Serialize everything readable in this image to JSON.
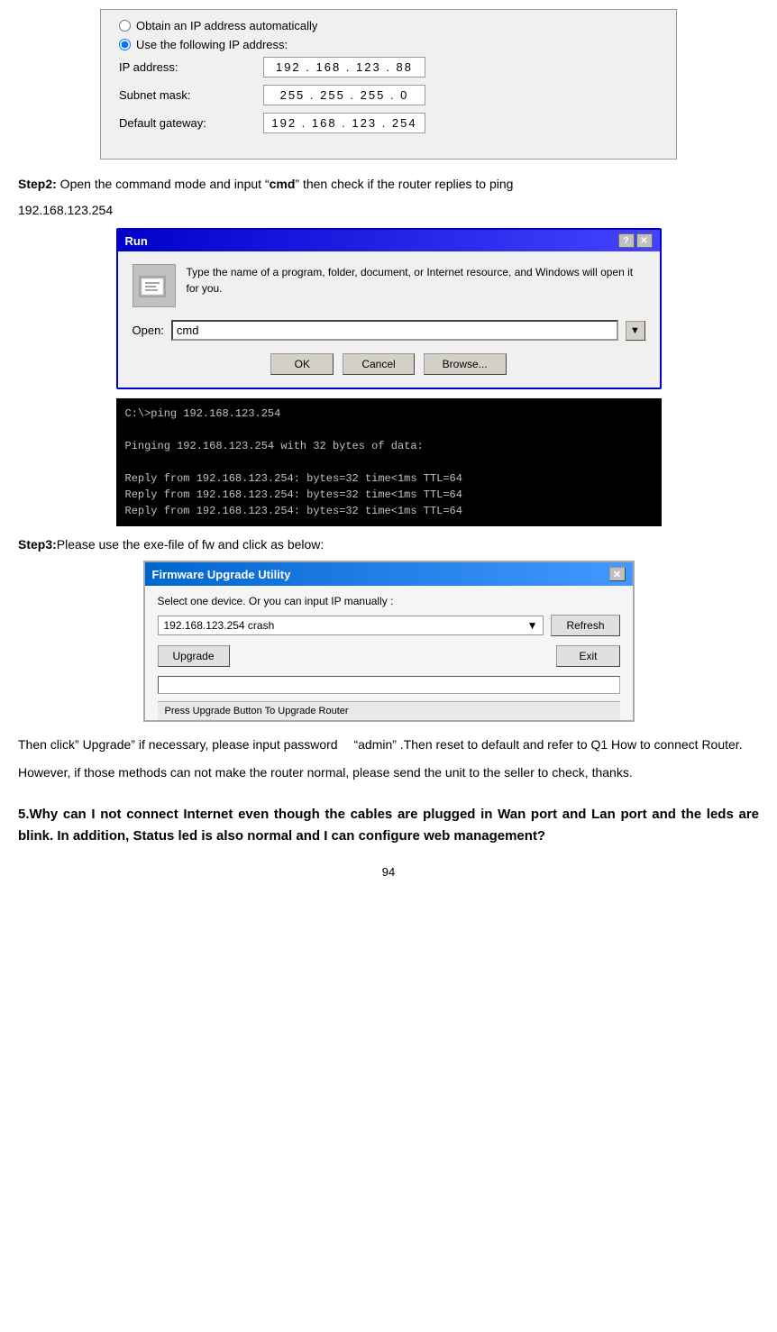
{
  "network_screenshot": {
    "obtain_auto_label": "Obtain an IP address automatically",
    "use_following_label": "Use the following IP address:",
    "ip_address_label": "IP address:",
    "ip_address_value": "192 . 168 . 123 . 88",
    "subnet_mask_label": "Subnet mask:",
    "subnet_mask_value": "255 . 255 . 255 . 0",
    "default_gateway_label": "Default gateway:",
    "default_gateway_value": "192 . 168 . 123 . 254"
  },
  "step2": {
    "label": "Step2:",
    "text": " Open the command mode and input “",
    "cmd": "cmd",
    "text2": "” then check if the router replies to ping"
  },
  "step2_ip": "192.168.123.254",
  "run_dialog": {
    "title": "Run",
    "description": "Type the name of a program, folder, document, or Internet resource, and Windows will open it for you.",
    "open_label": "Open:",
    "open_value": "cmd",
    "ok_label": "OK",
    "cancel_label": "Cancel",
    "browse_label": "Browse..."
  },
  "cmd_lines": [
    "C:\\>ping 192.168.123.254",
    "",
    "Pinging 192.168.123.254 with 32 bytes of data:",
    "",
    "Reply from 192.168.123.254: bytes=32 time<1ms TTL=64",
    "Reply from 192.168.123.254: bytes=32 time<1ms TTL=64",
    "Reply from 192.168.123.254: bytes=32 time<1ms TTL=64"
  ],
  "step3": {
    "label": "Step3:",
    "text": "Please use the exe-file of fw and click as below:"
  },
  "fw_dialog": {
    "title": "Firmware Upgrade Utility",
    "instruction": "Select one device. Or you can input IP manually :",
    "dropdown_value": "192.168.123.254   crash",
    "refresh_label": "Refresh",
    "upgrade_label": "Upgrade",
    "exit_label": "Exit",
    "statusbar_text": "Press Upgrade Button To Upgrade Router"
  },
  "paragraphs": [
    "Then click” Upgrade” if necessary, please input password 　“admin” .Then reset to default and refer to Q1 How to connect Router.",
    "However, if those methods can not make the router normal, please send the unit to the seller to check, thanks."
  ],
  "section5_heading": "5.Why can I not connect Internet even though the cables are plugged in Wan port and Lan port and the leds are blink. In addition, Status led is also normal and I can configure web management?",
  "page_number": "94"
}
